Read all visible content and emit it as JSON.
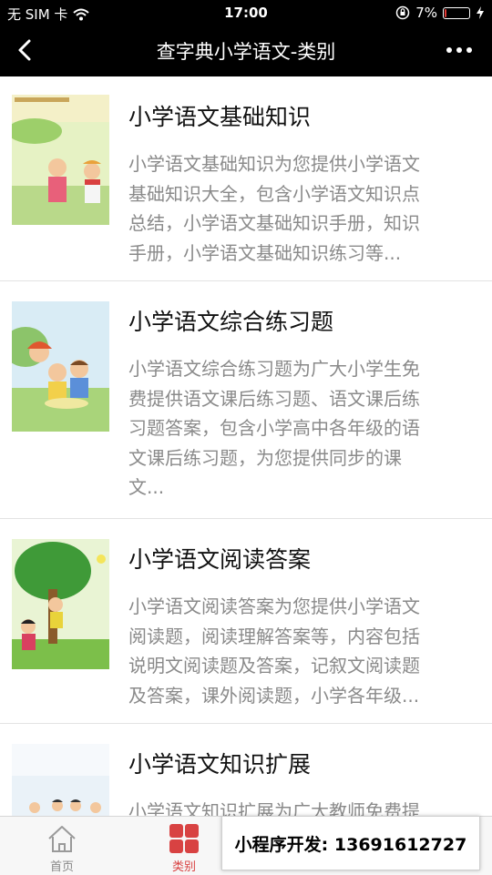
{
  "status_bar": {
    "carrier": "无 SIM 卡",
    "time": "17:00",
    "battery_percent_text": "7%",
    "battery_level": 0.07,
    "battery_color": "#e53935"
  },
  "nav": {
    "back_icon": "back-arrow-icon",
    "title": "查字典小学语文-类别",
    "more_icon": "more-dots-icon"
  },
  "items": [
    {
      "title": "小学语文基础知识",
      "lines": [
        "小学语文基础知识为您提供小学语文",
        "基础知识大全，包含小学语文知识点",
        "总结，小学语文基础知识手册，知识",
        "手册，小学语文基础知识练习等..."
      ]
    },
    {
      "title": "小学语文综合练习题",
      "lines": [
        "小学语文综合练习题为广大小学生免",
        "费提供语文课后练习题、语文课后练",
        "习题答案，包含小学高中各年级的语",
        "文课后练习题，为您提供同步的课",
        "文..."
      ]
    },
    {
      "title": "小学语文阅读答案",
      "lines": [
        "小学语文阅读答案为您提供小学语文",
        "阅读题，阅读理解答案等，内容包括",
        "说明文阅读题及答案，记叙文阅读题",
        "及答案，课外阅读题，小学各年级..."
      ]
    },
    {
      "title": "小学语文知识扩展",
      "lines": [
        "小学语文知识扩展为广大教师免费提"
      ]
    }
  ],
  "tabs": [
    {
      "label": "首页",
      "icon": "home-icon",
      "active": false
    },
    {
      "label": "类别",
      "icon": "category-grid-icon",
      "active": true
    }
  ],
  "accent_color": "#d84242",
  "promo": {
    "text": "小程序开发: 13691612727"
  }
}
